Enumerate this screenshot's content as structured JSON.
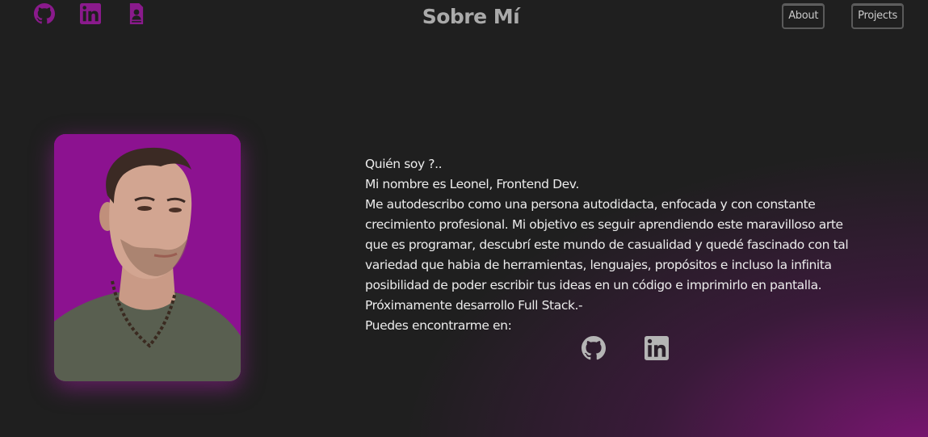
{
  "header": {
    "icons": [
      "github-icon",
      "linkedin-icon",
      "resume-icon"
    ],
    "title": "Sobre Mí",
    "nav": [
      {
        "label": "About"
      },
      {
        "label": "Projects"
      }
    ]
  },
  "profile": {
    "photo": "profile-photo"
  },
  "bio": {
    "lines": [
      "Quién soy ?..",
      "Mi nombre es Leonel, Frontend Dev.",
      "Me autodescribo como una persona autodidacta, enfocada y con constante",
      "crecimiento profesional. Mi objetivo es seguir aprendiendo este maravilloso arte",
      "que es programar, descubrí este mundo de casualidad y quedé fascinado con tal",
      "variedad que habia de herramientas, lenguajes, propósitos e incluso la infinita",
      "posibilidad de poder escribir tus ideas en un código e imprimirlo en pantalla.",
      "Próximamente desarrollo Full Stack.-",
      "Puedes encontrarme en:"
    ]
  },
  "social": {
    "icons": [
      "github-icon",
      "linkedin-icon"
    ]
  },
  "colors": {
    "accent": "#8c1290",
    "icon_purple": "#8a1a8c",
    "icon_gray": "#b5b5b5",
    "background": "#1f1f1f"
  }
}
